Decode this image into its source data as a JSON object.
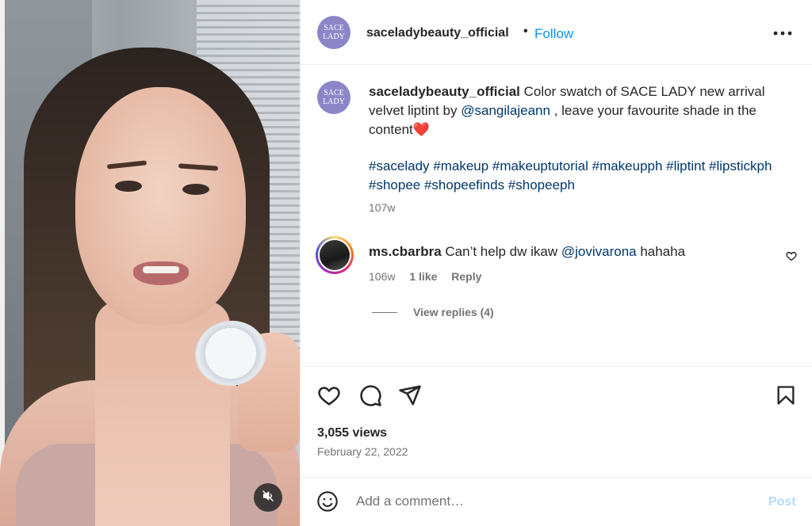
{
  "media": {
    "compact_text": "SACE LADY"
  },
  "post": {
    "brand_logo_line1": "SACE",
    "brand_logo_line2": "LADY",
    "author": "saceladybeauty_official",
    "dot": "•",
    "follow_label": "Follow",
    "more_label": "•••",
    "caption": {
      "author": "saceladybeauty_official",
      "text_part1": " Color swatch of SACE LADY new arrival velvet liptint by ",
      "mention": "@sangilajeann",
      "text_part2": " , leave your favourite shade in the content",
      "emoji": "❤️",
      "hashtags": "#sacelady #makeup #makeuptutorial #makeupph #liptint #lipstickph #shopee #shopeefinds #shopeeph",
      "age": "107w"
    },
    "comment": {
      "username": "ms.cbarbra",
      "text_part1": " Can’t help dw ikaw ",
      "mention": "@jovivarona",
      "text_part2": " hahaha",
      "age": "106w",
      "likes": "1 like",
      "reply_label": "Reply",
      "view_replies": "View replies (4)"
    },
    "views": "3,055 views",
    "date": "February 22, 2022",
    "add_comment_placeholder": "Add a comment…",
    "post_label": "Post"
  },
  "icons": {
    "mute": "muted-speaker-icon",
    "like": "heart-icon",
    "comment": "comment-icon",
    "share": "paper-plane-icon",
    "save": "bookmark-icon",
    "emoji": "smiley-icon"
  },
  "colors": {
    "accent": "#0095f6",
    "link": "#00376b",
    "muted": "#737373",
    "brand_avatar": "#8c86c9",
    "post_disabled": "#b3dbff"
  }
}
